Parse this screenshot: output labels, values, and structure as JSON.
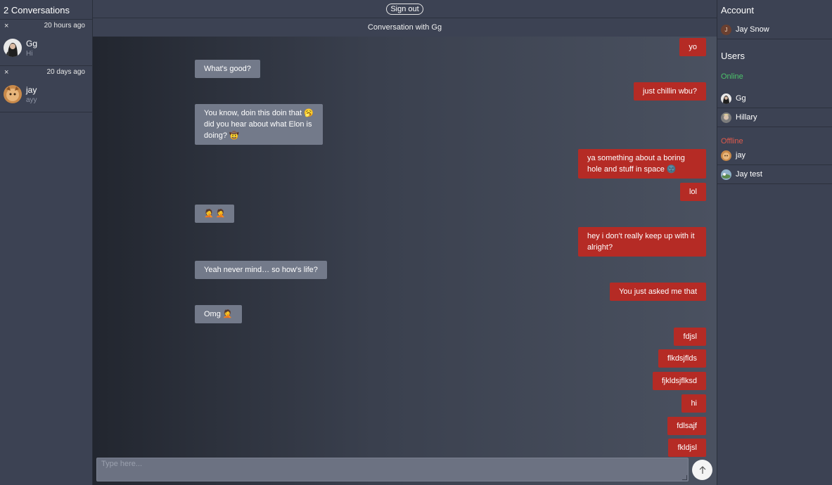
{
  "left": {
    "title": "2 Conversations",
    "conversations": [
      {
        "close": "×",
        "time": "20 hours ago",
        "name": "Gg",
        "last": "Hi"
      },
      {
        "close": "×",
        "time": "20 days ago",
        "name": "jay",
        "last": "ayy"
      }
    ]
  },
  "topbar": {
    "signout_label": "Sign out"
  },
  "header": {
    "title": "Conversation with Gg"
  },
  "messages": [
    {
      "from": "me",
      "text": "yo"
    },
    {
      "from": "them",
      "text": "What's good?"
    },
    {
      "from": "me",
      "text": "just chillin wbu?"
    },
    {
      "from": "them",
      "text": "You know, doin this doin that 🥱 did you hear about what Elon is doing? 🤠"
    },
    {
      "from": "me",
      "text": "ya something about a boring hole and stuff in space 🌚"
    },
    {
      "from": "me",
      "text": "lol"
    },
    {
      "from": "them",
      "text": "🤦 🤦"
    },
    {
      "from": "me",
      "text": "hey i don't really keep up with it alright?"
    },
    {
      "from": "them",
      "text": "Yeah never mind… so how's life?"
    },
    {
      "from": "me",
      "text": "You just asked me that"
    },
    {
      "from": "them",
      "text": "Omg 🤦"
    },
    {
      "from": "me",
      "text": "fdjsl"
    },
    {
      "from": "me",
      "text": "flkdsjflds"
    },
    {
      "from": "me",
      "text": "fjkldsjflksd"
    },
    {
      "from": "me",
      "text": "hi"
    },
    {
      "from": "me",
      "text": "fdlsajf"
    },
    {
      "from": "me",
      "text": "fkldjsl"
    }
  ],
  "composer": {
    "placeholder": "Type here...",
    "send_icon": "arrow-up-icon"
  },
  "right": {
    "account_title": "Account",
    "account": {
      "initial": "J",
      "name": "Jay Snow"
    },
    "users_title": "Users",
    "online_label": "Online",
    "online": [
      {
        "name": "Gg"
      },
      {
        "name": "Hillary"
      }
    ],
    "offline_label": "Offline",
    "offline": [
      {
        "name": "jay"
      },
      {
        "name": "Jay test"
      }
    ]
  },
  "colors": {
    "my_bubble": "#b52b25",
    "their_bubble": "#737a8a",
    "online": "#4cc36b",
    "offline": "#e05b4c"
  }
}
